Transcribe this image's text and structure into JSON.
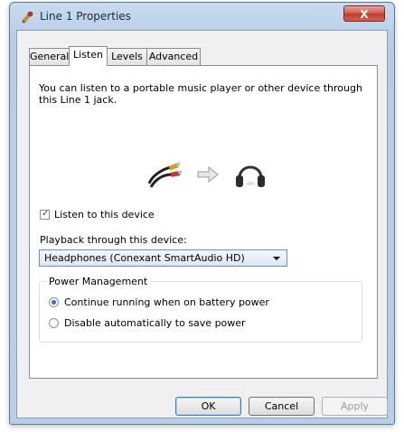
{
  "window": {
    "title": "Line 1 Properties",
    "close_label": "X"
  },
  "tabs": [
    {
      "label": "General"
    },
    {
      "label": "Listen"
    },
    {
      "label": "Levels"
    },
    {
      "label": "Advanced"
    }
  ],
  "listen": {
    "description": "You can listen to a portable music player or other device through this Line 1 jack.",
    "checkbox_label": "Listen to this device",
    "checkbox_checked": true,
    "playback_label": "Playback through this device:",
    "playback_device": "Headphones (Conexant SmartAudio HD)",
    "power_group_title": "Power Management",
    "radio_options": [
      {
        "label": "Continue running when on battery power",
        "selected": true
      },
      {
        "label": "Disable automatically to save power",
        "selected": false
      }
    ]
  },
  "buttons": {
    "ok": "OK",
    "cancel": "Cancel",
    "apply": "Apply"
  },
  "icons": {
    "source": "audio-cable-icon",
    "arrow": "right-arrow-icon",
    "target": "headphones-icon"
  }
}
